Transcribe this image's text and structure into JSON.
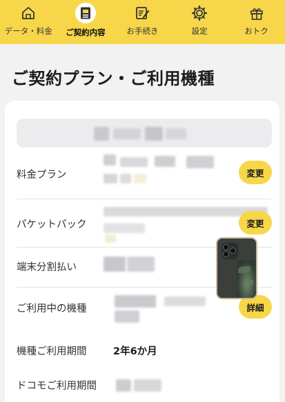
{
  "tabs": [
    {
      "label": "データ・料金",
      "icon": "home-icon",
      "active": false
    },
    {
      "label": "ご契約内容",
      "icon": "document-icon",
      "active": true
    },
    {
      "label": "お手続き",
      "icon": "edit-icon",
      "active": false
    },
    {
      "label": "設定",
      "icon": "gear-icon",
      "active": false
    },
    {
      "label": "おトク",
      "icon": "gift-icon",
      "active": false
    }
  ],
  "page": {
    "title": "ご契約プラン・ご利用機種"
  },
  "rows": {
    "plan": {
      "label": "料金プラン",
      "button": "変更"
    },
    "packet": {
      "label": "パケットパック",
      "button": "変更"
    },
    "installment": {
      "label": "端末分割払い"
    },
    "device": {
      "label": "ご利用中の機種",
      "button": "詳細"
    },
    "device_period": {
      "label": "機種ご利用期間",
      "value": "2年6か月"
    },
    "docomo_period": {
      "label": "ドコモご利用期間"
    }
  },
  "colors": {
    "accent": "#f7d64a",
    "background": "#f2f2f2",
    "card": "#ffffff"
  }
}
